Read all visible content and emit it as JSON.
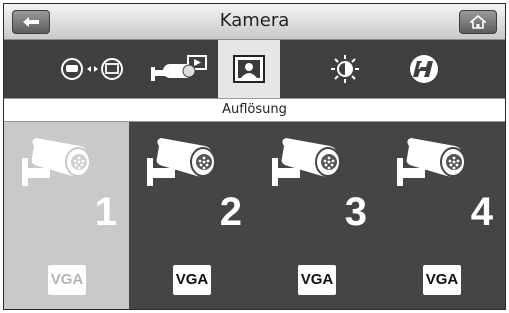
{
  "header": {
    "title": "Kamera",
    "back_icon": "back-arrow-icon",
    "home_icon": "home-icon"
  },
  "tabs": [
    {
      "icon": "camera-to-monitor-icon",
      "active": false
    },
    {
      "icon": "camera-video-icon",
      "active": false
    },
    {
      "icon": "image-resolution-icon",
      "active": true
    },
    {
      "icon": "brightness-icon",
      "active": false
    },
    {
      "icon": "h-mode-icon",
      "active": false
    }
  ],
  "section_label": "Auflösung",
  "cameras": [
    {
      "number": "1",
      "resolution": "VGA",
      "selected": true
    },
    {
      "number": "2",
      "resolution": "VGA",
      "selected": false
    },
    {
      "number": "3",
      "resolution": "VGA",
      "selected": false
    },
    {
      "number": "4",
      "resolution": "VGA",
      "selected": false
    }
  ],
  "colors": {
    "panel": "#454545",
    "selected": "#c9c9c9",
    "active_tab": "#e6e6e6"
  }
}
